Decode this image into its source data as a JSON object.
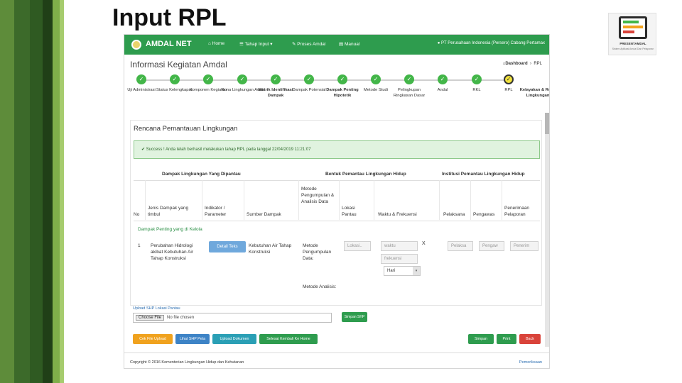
{
  "slide": {
    "title": "Input RPL",
    "logo_caption": "PRESENTAMDAL",
    "logo_subcaption": "Sistem Aplikasi Amdal Dan Pelaporan"
  },
  "app": {
    "brand": "AMDAL NET",
    "nav": [
      "Home",
      "Tahap Input",
      "Proses Amdal",
      "Manual"
    ],
    "user": "PT Perusahaan Indonesia (Persero) Cabang Pertamax",
    "page_title": "Informasi Kegiatan Amdal",
    "breadcrumb": [
      "Dashboard",
      "RPL"
    ]
  },
  "steps": [
    {
      "label": "Uji Administrasi",
      "state": "done"
    },
    {
      "label": "Status Kelengkapan",
      "state": "done"
    },
    {
      "label": "Komponen Kegiatan",
      "state": "done"
    },
    {
      "label": "Rona Lingkungan Awal",
      "state": "done"
    },
    {
      "label": "Matrik Identifikasi Dampak",
      "state": "done"
    },
    {
      "label": "Dampak Potensial",
      "state": "done"
    },
    {
      "label": "Dampak Penting Hipotetik",
      "state": "done"
    },
    {
      "label": "Metode Studi",
      "state": "done"
    },
    {
      "label": "Pelingkupan Ringkasan Dasar",
      "state": "done"
    },
    {
      "label": "Andal",
      "state": "done"
    },
    {
      "label": "RKL",
      "state": "done"
    },
    {
      "label": "RPL",
      "state": "active"
    },
    {
      "label": "Kelayakan & Rona Lingkungan",
      "state": "pending"
    }
  ],
  "section": {
    "title": "Rencana Pemantauan Lingkungan",
    "alert": "Success ! Anda telah berhasil melakukan tahap RPL pada tanggal 22/04/2019 11:21:07"
  },
  "table": {
    "group_headers": [
      "Dampak Lingkungan Yang Dipantau",
      "Bentuk Pemantau Lingkungan Hidup",
      "Institusi Pemantau Lingkungan Hidup"
    ],
    "columns": [
      "No",
      "Jenis Dampak yang timbul",
      "Indikator / Parameter",
      "Sumber Dampak",
      "Metode Pengumpulan & Analisis Data",
      "Lokasi Pantau",
      "Waktu & Frekuensi",
      "Pelaksana",
      "Pengawas",
      "Penerimaan Pelaporan"
    ],
    "group_label": "Dampak Penting yang di Kelola",
    "row": {
      "no": "1",
      "jenis": "Perubahan Hidrologi akibat Kebutuhan Air Tahap Konstruksi",
      "detail_button": "Detail Teks",
      "sumber": "Kebutuhan Air Tahap Konstruksi",
      "metode1": "Metode Pengumpulan Data:",
      "metode2": "Metode Analisis:",
      "lokasi_placeholder": "Lokasi..",
      "waktu_placeholder": "waktu",
      "frekuensi_placeholder": "frekuensi",
      "satuan": "Hari",
      "remove": "X",
      "pelaksana_placeholder": "Pelaksa",
      "pengawas_placeholder": "Pengaw",
      "penerima_placeholder": "Penerim"
    }
  },
  "upload": {
    "label": "Upload SHP Lokasi Pantau",
    "choose": "Choose File",
    "status": "No file chosen",
    "button": "Simpan SHP"
  },
  "actions": {
    "left": [
      {
        "label": "Cek File Upload",
        "color": "#f0a21e"
      },
      {
        "label": "Lihat SHP Peta",
        "color": "#3d83c6"
      },
      {
        "label": "Upload Dokumen",
        "color": "#2a9fb5"
      },
      {
        "label": "Selesai Kembali Ke Home",
        "color": "#2e9c4e"
      }
    ],
    "right": [
      {
        "label": "Simpan",
        "color": "#2e9c4e"
      },
      {
        "label": "Print",
        "color": "#2e9c4e"
      },
      {
        "label": "Back",
        "color": "#d9433a"
      }
    ]
  },
  "footer": {
    "copyright": "Copyright © 2016 Kementerian Lingkungan Hidup dan Kehutanan",
    "right": "Pemeriksaan"
  },
  "colors": {
    "navbar": "#2e9c4e",
    "step_done": "#43b649",
    "step_active": "#f2e33c"
  }
}
